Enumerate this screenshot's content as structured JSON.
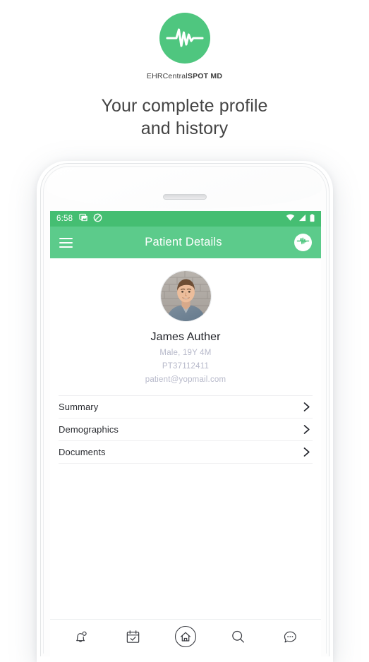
{
  "promo": {
    "logo": {
      "icon": "ekg-pulse-icon",
      "brand_light": "EHRCentral",
      "brand_bold": "SPOT MD",
      "circle_color": "#4FC67F"
    },
    "headline_line1": "Your complete profile",
    "headline_line2": "and history"
  },
  "phone": {
    "status_bar": {
      "time": "6:58",
      "bg_color": "#45BE72",
      "left_icons": [
        "gallery-icon",
        "do-not-disturb-icon"
      ],
      "right_icons": [
        "wifi-icon",
        "signal-icon",
        "battery-icon"
      ]
    },
    "app_bar": {
      "menu_icon": "hamburger-menu-icon",
      "title": "Patient Details",
      "avatar_icon": "ekg-pulse-icon",
      "bg_color": "#5CCB8B"
    },
    "profile": {
      "avatar": "patient-photo",
      "name": "James Auther",
      "gender_age": "Male, 19Y 4M",
      "patient_id": "PT37112411",
      "email": "patient@yopmail.com"
    },
    "menu_rows": [
      {
        "label": "Summary",
        "chevron": "chevron-right-icon"
      },
      {
        "label": "Demographics",
        "chevron": "chevron-right-icon"
      },
      {
        "label": "Documents",
        "chevron": "chevron-right-icon"
      }
    ],
    "bottom_nav": [
      {
        "icon": "bell-notification-icon",
        "active": false
      },
      {
        "icon": "calendar-check-icon",
        "active": false
      },
      {
        "icon": "home-icon",
        "active": true
      },
      {
        "icon": "search-icon",
        "active": false
      },
      {
        "icon": "chat-bubble-icon",
        "active": false
      }
    ]
  }
}
